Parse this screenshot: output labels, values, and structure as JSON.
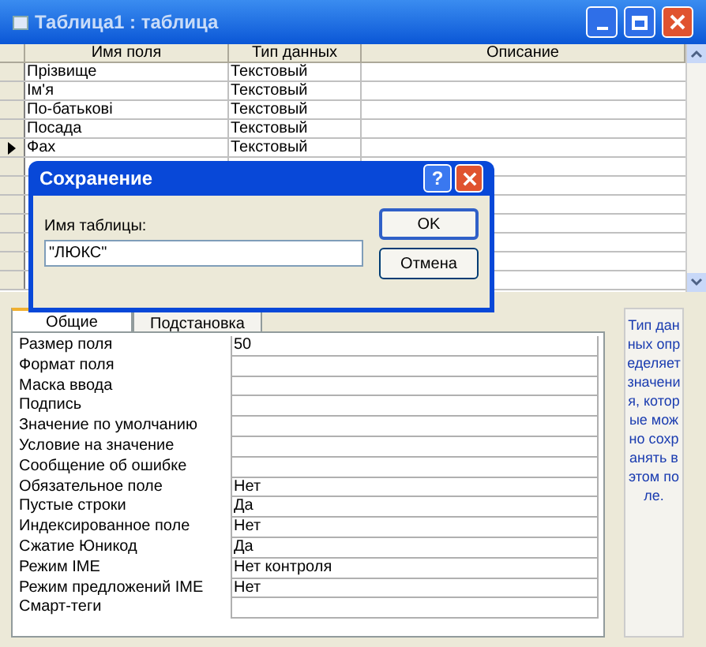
{
  "window": {
    "title": "Таблица1 : таблица"
  },
  "grid": {
    "columns": [
      "Имя поля",
      "Тип данных",
      "Описание"
    ],
    "rows": [
      {
        "name": "Прізвище",
        "type": "Текстовый",
        "selected": false
      },
      {
        "name": "Ім'я",
        "type": "Текстовый",
        "selected": false
      },
      {
        "name": "По-батькові",
        "type": "Текстовый",
        "selected": false
      },
      {
        "name": "Посада",
        "type": "Текстовый",
        "selected": false
      },
      {
        "name": "Фах",
        "type": "Текстовый",
        "selected": true
      }
    ]
  },
  "tabs": [
    {
      "label": "Общие",
      "selected": true
    },
    {
      "label": "Подстановка",
      "selected": false
    }
  ],
  "properties": [
    {
      "label": "Размер поля",
      "value": "50"
    },
    {
      "label": "Формат поля"
    },
    {
      "label": "Маска ввода"
    },
    {
      "label": "Подпись"
    },
    {
      "label": "Значение по умолчанию"
    },
    {
      "label": "Условие на значение"
    },
    {
      "label": "Сообщение об ошибке"
    },
    {
      "label": "Обязательное поле",
      "value": "Нет"
    },
    {
      "label": "Пустые строки",
      "value": "Да"
    },
    {
      "label": "Индексированное поле",
      "value": "Нет"
    },
    {
      "label": "Сжатие Юникод",
      "value": "Да"
    },
    {
      "label": "Режим IME",
      "value": "Нет контроля"
    },
    {
      "label": "Режим предложений IME",
      "value": "Нет"
    },
    {
      "label": "Смарт-теги"
    }
  ],
  "help": "Тип данных определяет значения, которые можно сохранять в этом поле.",
  "dialog": {
    "title": "Сохранение",
    "help_button": "?",
    "label": "Имя таблицы:",
    "value": "\"ЛЮКС\"",
    "buttons": [
      "OK",
      "Отмена"
    ]
  }
}
